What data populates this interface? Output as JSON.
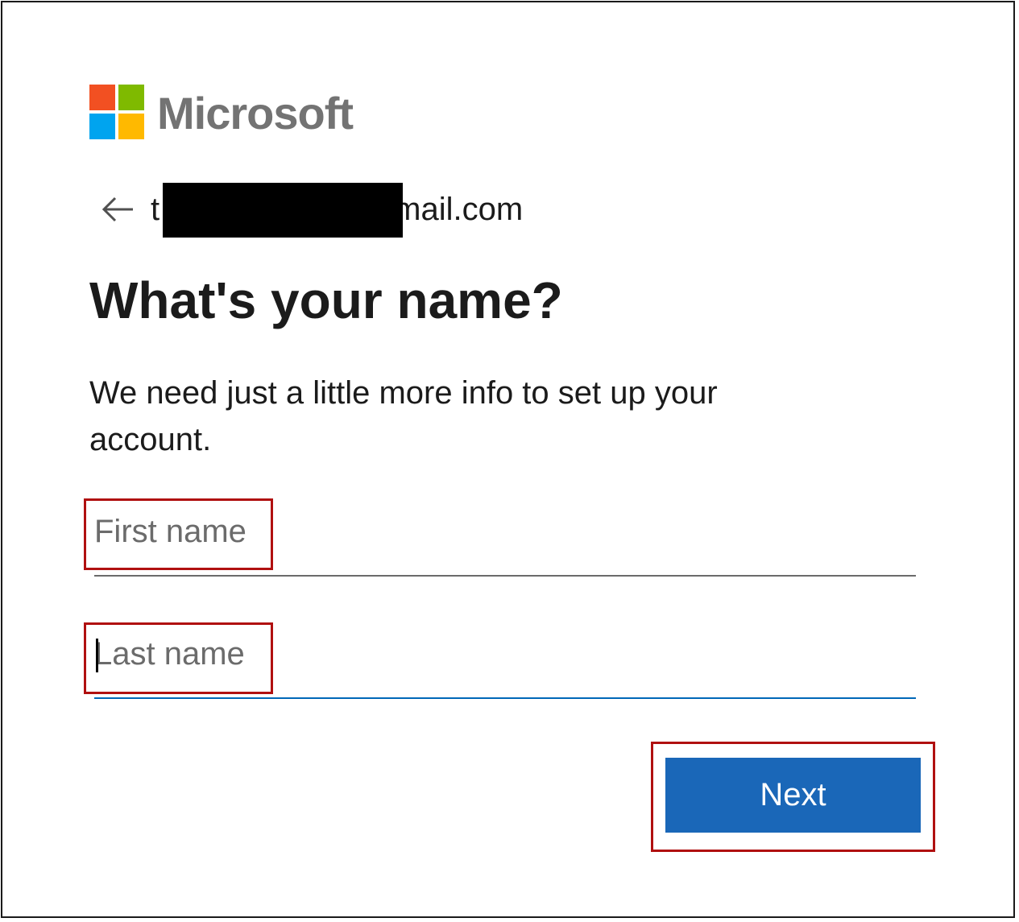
{
  "brand": {
    "name": "Microsoft",
    "name_color": "#737373",
    "logo_colors": {
      "red": "#f25022",
      "green": "#7fba00",
      "blue": "#00a4ef",
      "yellow": "#ffb900"
    }
  },
  "identity": {
    "back_icon": "arrow-left-icon",
    "email_prefix": "t",
    "email_suffix": "mail.com",
    "redacted": true
  },
  "heading": "What's your name?",
  "subtitle": "We need just a little more info to set up your account.",
  "form": {
    "first_name": {
      "placeholder": "First name",
      "value": ""
    },
    "last_name": {
      "placeholder": "Last name",
      "value": "",
      "focused": true
    }
  },
  "next_button": {
    "label": "Next",
    "color": "#1a67b8"
  },
  "highlight_color": "#b01010"
}
